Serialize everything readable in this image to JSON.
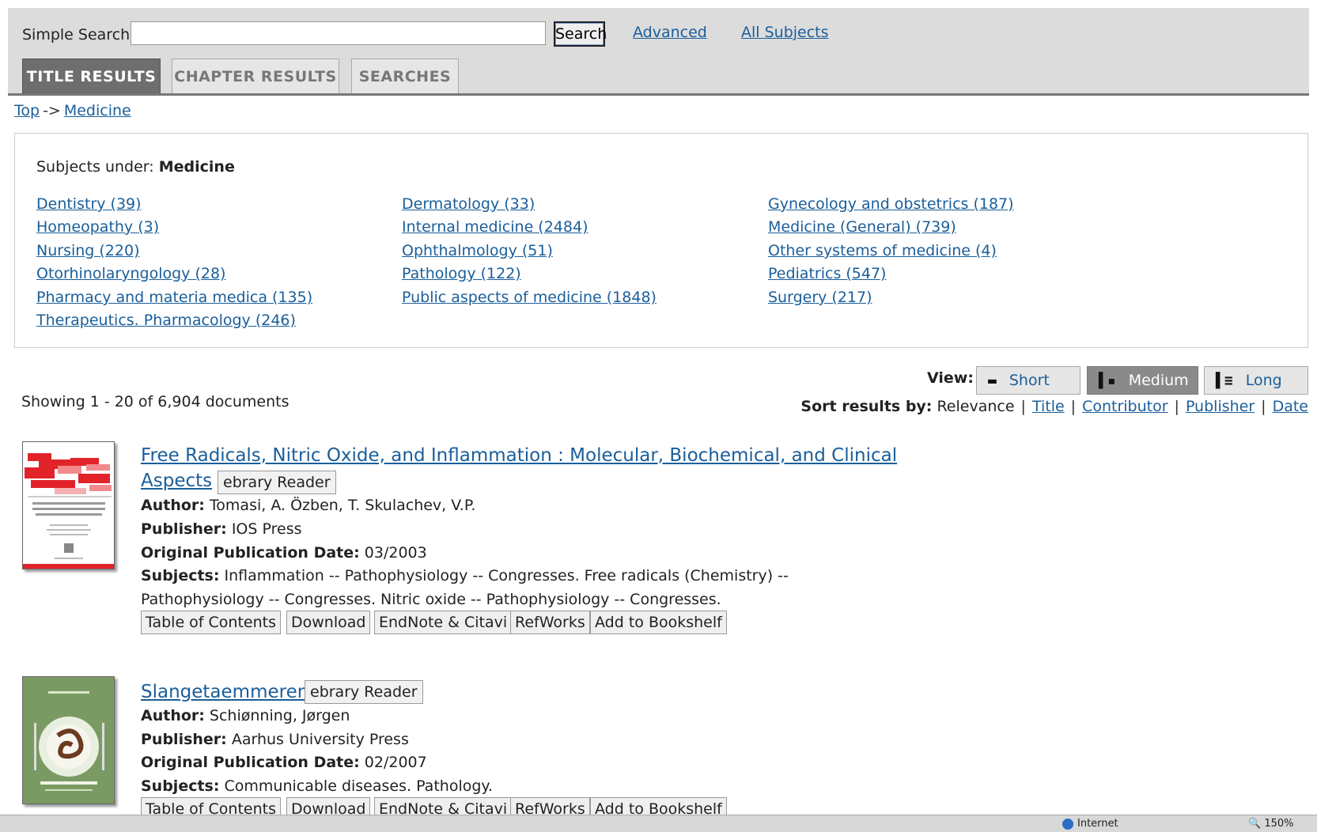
{
  "search": {
    "label": "Simple Search:",
    "value": "",
    "placeholder": "",
    "button": "Search",
    "advanced": "Advanced",
    "all_subjects": "All Subjects"
  },
  "tabs": [
    {
      "label": "TITLE RESULTS",
      "active": true
    },
    {
      "label": "CHAPTER RESULTS",
      "active": false
    },
    {
      "label": "SEARCHES",
      "active": false
    }
  ],
  "breadcrumb": {
    "top": "Top",
    "sep": "->",
    "current": "Medicine"
  },
  "subjects": {
    "heading": "Subjects under:",
    "parent": "Medicine",
    "columns": [
      [
        "Dentistry (39)",
        "Homeopathy (3)",
        "Nursing (220)",
        "Otorhinolaryngology (28)",
        "Pharmacy and materia medica (135)",
        "Therapeutics. Pharmacology (246)"
      ],
      [
        "Dermatology (33)",
        "Internal medicine (2484)",
        "Ophthalmology (51)",
        "Pathology (122)",
        "Public aspects of medicine (1848)"
      ],
      [
        "Gynecology and obstetrics (187)",
        "Medicine (General) (739)",
        "Other systems of medicine (4)",
        "Pediatrics (547)",
        "Surgery (217)"
      ]
    ]
  },
  "view": {
    "label": "View:",
    "options": [
      {
        "label": "Short",
        "icon": "short-view-icon",
        "active": false
      },
      {
        "label": "Medium",
        "icon": "medium-view-icon",
        "active": true
      },
      {
        "label": "Long",
        "icon": "long-view-icon",
        "active": false
      }
    ]
  },
  "showing": "Showing 1 - 20 of 6,904 documents",
  "sort": {
    "label": "Sort results by:",
    "current": "Relevance",
    "options": [
      "Title",
      "Contributor",
      "Publisher",
      "Date"
    ]
  },
  "results": [
    {
      "title_line1": "Free Radicals, Nitric Oxide, and Inflammation : Molecular, Biochemical, and Clinical",
      "title_line2": "Aspects",
      "reader": "ebrary Reader",
      "author_label": "Author:",
      "author": "Tomasi, A.   Özben, T.   Skulachev, V.P.",
      "publisher_label": "Publisher:",
      "publisher": "IOS Press",
      "date_label": "Original Publication Date:",
      "date": "03/2003",
      "subjects_label": "Subjects:",
      "subjects_line1": "Inflammation -- Pathophysiology -- Congresses.   Free radicals (Chemistry) --",
      "subjects_line2": "Pathophysiology -- Congresses.   Nitric oxide -- Pathophysiology -- Congresses.",
      "cover_text": "Free Radicals, Nitric Oxide, and Inflammation: Molecular, Biochemical, and Clinical Aspects"
    },
    {
      "title_line1": "Slangetaemmeren",
      "reader": "ebrary Reader",
      "author_label": "Author:",
      "author": "Schiønning, Jørgen",
      "publisher_label": "Publisher:",
      "publisher": "Aarhus University Press",
      "date_label": "Original Publication Date:",
      "date": "02/2007",
      "subjects_label": "Subjects:",
      "subjects_line1": "Communicable diseases.   Pathology.",
      "cover_author": "Jørgen Schiønning",
      "cover_title": "Slangetæmmeren"
    }
  ],
  "actions": [
    "Table of Contents",
    "Download",
    "EndNote & Citavi",
    "RefWorks",
    "Add to Bookshelf"
  ],
  "statusbar": {
    "zone": "Internet",
    "zoom": "150%"
  },
  "colors": {
    "link": "#1a5e9a",
    "active_tab": "#6e6e6e",
    "topbar": "#dcdcdc",
    "cover_red": "#e2232a",
    "cover_green": "#7a9a64"
  }
}
